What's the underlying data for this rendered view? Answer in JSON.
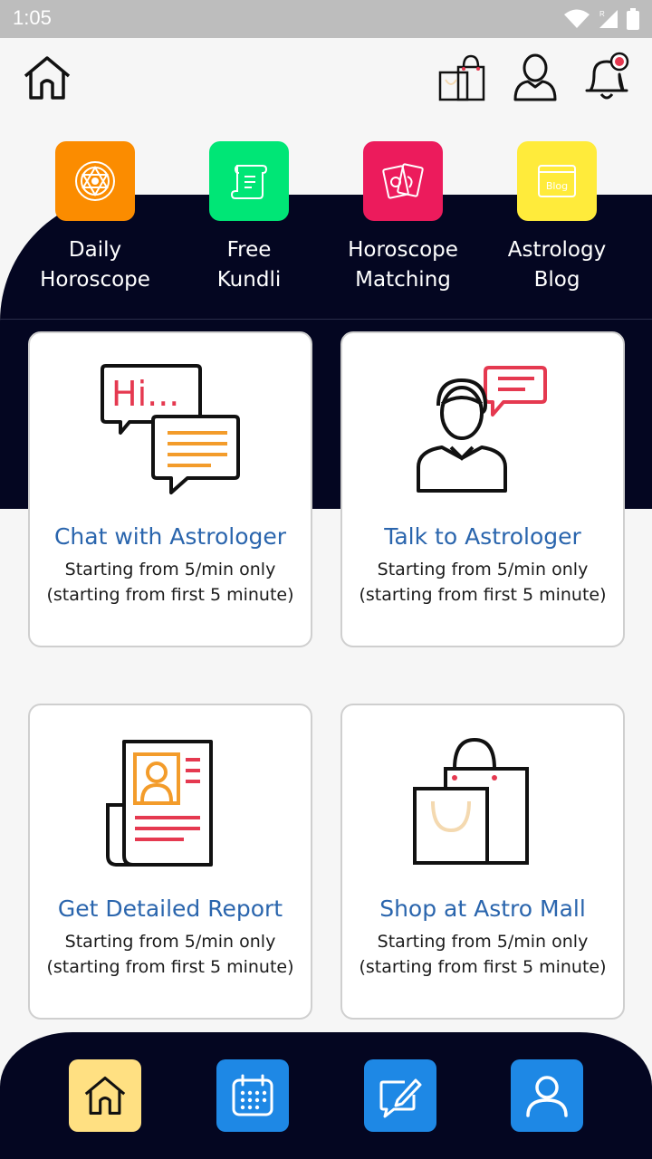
{
  "status": {
    "time": "1:05"
  },
  "quick_links": [
    {
      "label_line1": "Daily",
      "label_line2": "Horoscope",
      "color": "#fb8c00",
      "icon": "mandala-icon"
    },
    {
      "label_line1": "Free",
      "label_line2": "Kundli",
      "color": "#00e676",
      "icon": "scroll-icon"
    },
    {
      "label_line1": "Horoscope",
      "label_line2": "Matching",
      "color": "#ec1b5c",
      "icon": "tarot-cards-icon"
    },
    {
      "label_line1": "Astrology",
      "label_line2": "Blog",
      "color": "#ffeb3b",
      "icon": "blog-icon",
      "icon_text": "Blog"
    }
  ],
  "cards": [
    {
      "title": "Chat with Astrologer",
      "line1": "Starting from 5/min only",
      "line2": "(starting from first 5 minute)",
      "illus_text": "Hi..."
    },
    {
      "title": "Talk to Astrologer",
      "line1": "Starting from 5/min only",
      "line2": "(starting from first 5 minute)"
    },
    {
      "title": "Get Detailed Report",
      "line1": "Starting from 5/min only",
      "line2": "(starting from first 5 minute)"
    },
    {
      "title": "Shop at Astro Mall",
      "line1": "Starting from 5/min only",
      "line2": "(starting from first 5 minute)"
    }
  ],
  "bottom_nav": [
    {
      "icon": "home-icon",
      "color": "#ffe082"
    },
    {
      "icon": "calendar-icon",
      "color": "#1e88e5"
    },
    {
      "icon": "edit-note-icon",
      "color": "#1e88e5"
    },
    {
      "icon": "user-icon",
      "color": "#1e88e5"
    }
  ],
  "colors": {
    "dark": "#040621",
    "accent_text": "#2a65ad",
    "status_bar": "#bdbdbd"
  }
}
